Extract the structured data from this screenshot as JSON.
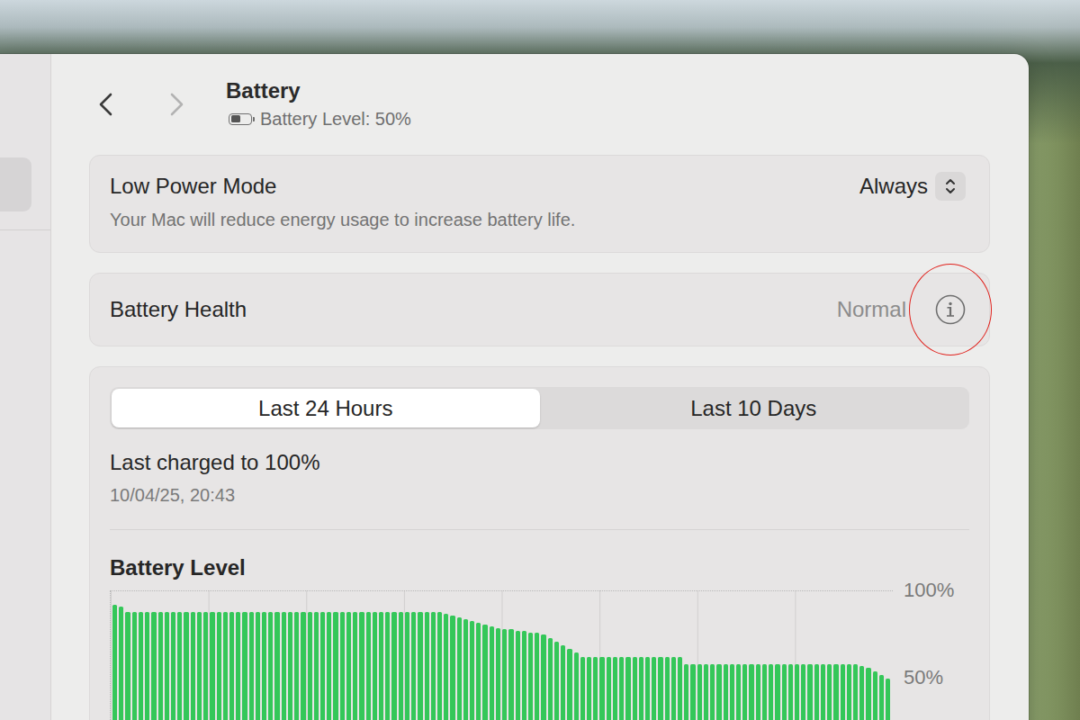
{
  "window": {
    "title": "Battery",
    "subtitle": "Battery Level: 50%",
    "battery_level": 0.5
  },
  "navigation": {
    "back": {
      "enabled": true
    },
    "forward": {
      "enabled": false
    }
  },
  "sidebar": {
    "items": [
      {
        "selected": true
      }
    ]
  },
  "low_power_mode": {
    "label": "Low Power Mode",
    "description": "Your Mac will reduce energy usage to increase battery life.",
    "value": "Always"
  },
  "battery_health": {
    "label": "Battery Health",
    "value": "Normal",
    "info_highlighted": true
  },
  "tabs": [
    {
      "label": "Last 24 Hours",
      "selected": true
    },
    {
      "label": "Last 10 Days",
      "selected": false
    }
  ],
  "last_charged": {
    "label": "Last charged to 100%",
    "time": "10/04/25, 20:43"
  },
  "chart": {
    "title": "Battery Level",
    "y_max": 100,
    "y_ticks": [
      {
        "label": "100%",
        "value": 100
      },
      {
        "label": "50%",
        "value": 50
      }
    ],
    "series": [
      {
        "name": "Battery Level",
        "color": "#34c759",
        "values": [
          92,
          91,
          88,
          88,
          88,
          88,
          88,
          88,
          88,
          88,
          88,
          88,
          88,
          88,
          88,
          88,
          88,
          88,
          88,
          88,
          88,
          88,
          88,
          88,
          88,
          88,
          88,
          88,
          88,
          88,
          88,
          88,
          88,
          88,
          88,
          88,
          88,
          88,
          88,
          88,
          88,
          88,
          88,
          88,
          88,
          88,
          88,
          88,
          88,
          88,
          88,
          87,
          86,
          85,
          84,
          83,
          82,
          81,
          80,
          79,
          78,
          78,
          77,
          77,
          76,
          76,
          75,
          73,
          71,
          69,
          67,
          65,
          62,
          62,
          62,
          62,
          62,
          62,
          62,
          62,
          62,
          62,
          62,
          62,
          62,
          62,
          62,
          62,
          58,
          58,
          58,
          58,
          58,
          58,
          58,
          58,
          58,
          58,
          58,
          58,
          58,
          58,
          58,
          58,
          58,
          58,
          58,
          58,
          58,
          58,
          58,
          58,
          58,
          58,
          58,
          57,
          56,
          54,
          52,
          50
        ]
      }
    ]
  }
}
